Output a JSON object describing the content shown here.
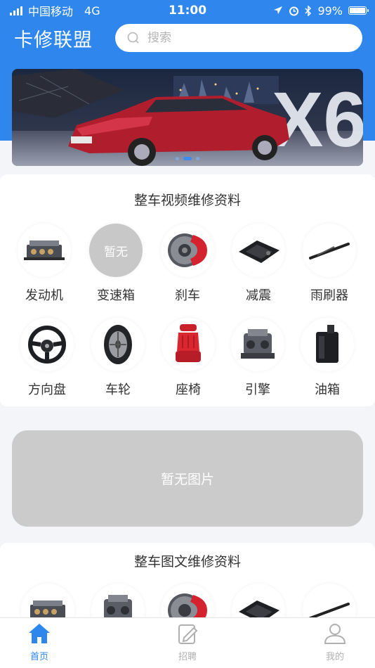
{
  "status_bar": {
    "carrier": "中国移动",
    "network": "4G",
    "time": "11:00",
    "battery": "99%",
    "battery_level": 0.99
  },
  "header": {
    "title": "卡修联盟",
    "search_placeholder": "搜索"
  },
  "banner": {
    "model_text": "X6",
    "slide_count": 3,
    "active_slide": 1
  },
  "video_section": {
    "title": "整车视频维修资料",
    "items": [
      {
        "label": "发动机",
        "icon": "engine-block-icon"
      },
      {
        "label": "变速箱",
        "icon": "placeholder",
        "placeholder": "暂无"
      },
      {
        "label": "刹车",
        "icon": "brake-disc-icon"
      },
      {
        "label": "减震",
        "icon": "shock-absorber-icon"
      },
      {
        "label": "雨刷器",
        "icon": "wiper-icon"
      },
      {
        "label": "方向盘",
        "icon": "steering-wheel-icon"
      },
      {
        "label": "车轮",
        "icon": "tire-icon"
      },
      {
        "label": "座椅",
        "icon": "seat-icon"
      },
      {
        "label": "引擎",
        "icon": "motor-icon"
      },
      {
        "label": "油箱",
        "icon": "fuel-tank-icon"
      }
    ]
  },
  "no_image": {
    "text": "暂无图片"
  },
  "text_section": {
    "title": "整车图文维修资料"
  },
  "bottom_nav": [
    {
      "label": "首页",
      "icon": "home-icon",
      "active": true
    },
    {
      "label": "招聘",
      "icon": "edit-icon",
      "active": false
    },
    {
      "label": "我的",
      "icon": "user-icon",
      "active": false
    }
  ],
  "colors": {
    "primary": "#2f86ec",
    "inactive": "#b0b0b0",
    "placeholder": "#cbcbcb"
  }
}
